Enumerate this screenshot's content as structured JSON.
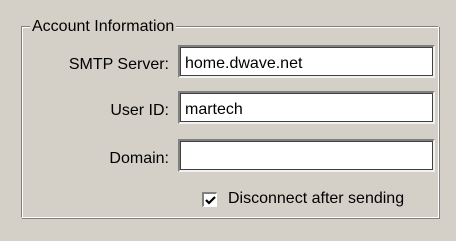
{
  "account_info": {
    "title": "Account Information",
    "smtp_server": {
      "label": "SMTP Server:",
      "value": "home.dwave.net"
    },
    "user_id": {
      "label": "User ID:",
      "value": "martech"
    },
    "domain": {
      "label": "Domain:",
      "value": ""
    },
    "disconnect": {
      "label": "Disconnect after sending",
      "checked": true
    }
  }
}
